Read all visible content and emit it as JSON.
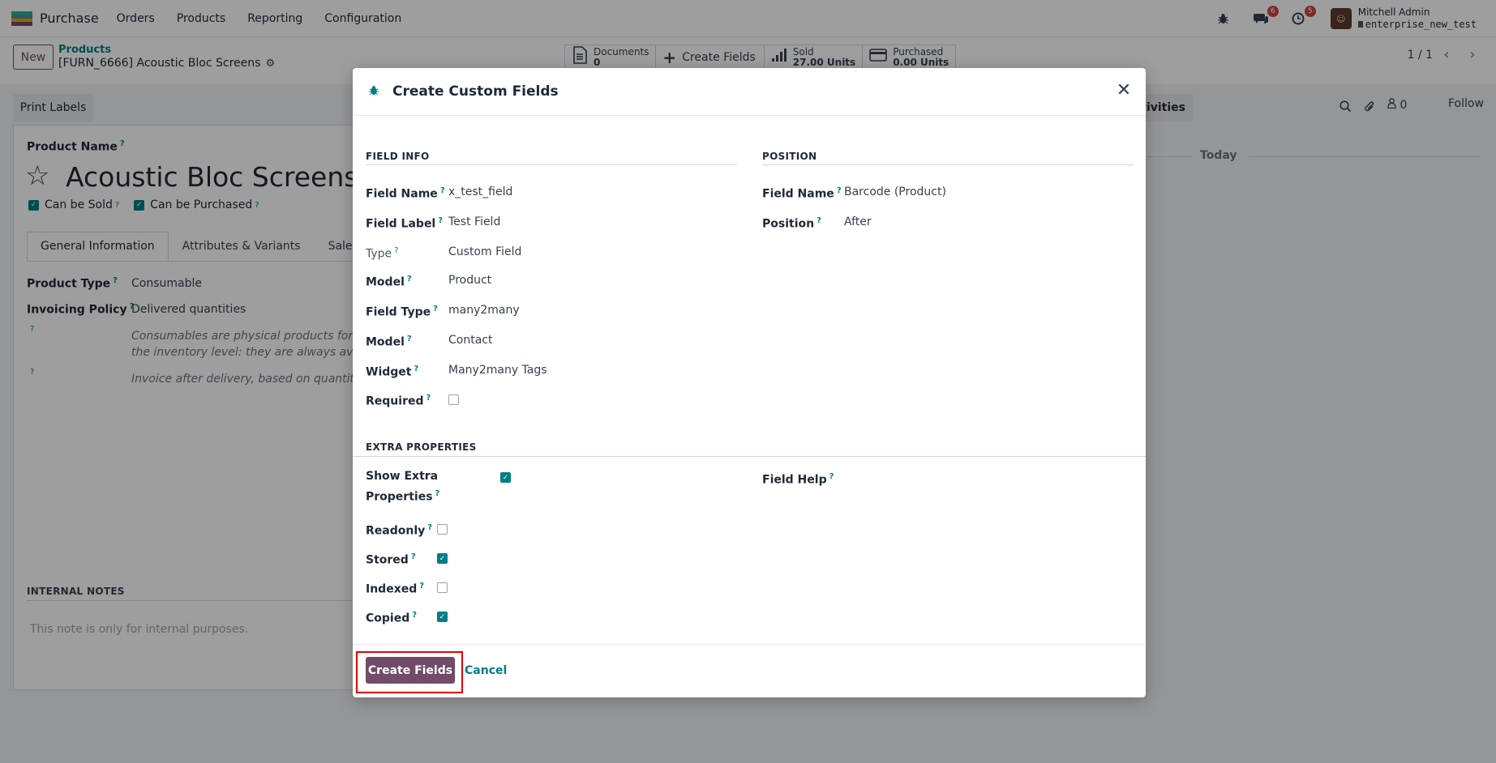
{
  "navbar": {
    "brand": "Purchase",
    "menu": [
      "Orders",
      "Products",
      "Reporting",
      "Configuration"
    ],
    "chat_badge": "6",
    "activity_badge": "5",
    "user_name": "Mitchell Admin",
    "user_db": "enterprise_new_test"
  },
  "control": {
    "new_label": "New",
    "breadcrumb_parent": "Products",
    "breadcrumb_current": "[FURN_6666] Acoustic Bloc Screens",
    "pager": "1 / 1",
    "stats": {
      "documents_label": "Documents",
      "documents_value": "0",
      "create_fields_label": "Create Fields",
      "sold_label": "Sold",
      "sold_value": "27.00 Units",
      "purchased_label": "Purchased",
      "purchased_value": "0.00 Units"
    }
  },
  "form": {
    "print_labels": "Print Labels",
    "product_name_label": "Product Name",
    "product_name": "Acoustic Bloc Screens",
    "can_be_sold": "Can be Sold",
    "can_be_purchased": "Can be Purchased",
    "tabs": [
      "General Information",
      "Attributes & Variants",
      "Sales"
    ],
    "product_type_label": "Product Type",
    "product_type": "Consumable",
    "invoicing_policy_label": "Invoicing Policy",
    "invoicing_policy": "Delivered quantities",
    "note1_line1": "Consumables are physical products for which",
    "note1_line2": "the inventory level: they are always available",
    "note2": "Invoice after delivery, based on quantities de",
    "internal_notes_title": "INTERNAL NOTES",
    "internal_notes_placeholder": "This note is only for internal purposes."
  },
  "chatter": {
    "activities": "ctivities",
    "followers_count": "0",
    "follow": "Follow",
    "today": "Today"
  },
  "modal": {
    "title": "Create Custom Fields",
    "field_info_title": "FIELD INFO",
    "position_title": "POSITION",
    "extra_title": "EXTRA PROPERTIES",
    "field_info": {
      "field_name_label": "Field Name",
      "field_name": "x_test_field",
      "field_label_label": "Field Label",
      "field_label": "Test Field",
      "type_label": "Type",
      "type": "Custom Field",
      "model_label": "Model",
      "model": "Product",
      "field_type_label": "Field Type",
      "field_type": "many2many",
      "model2_label": "Model",
      "model2": "Contact",
      "widget_label": "Widget",
      "widget": "Many2many Tags",
      "required_label": "Required"
    },
    "position": {
      "field_name_label": "Field Name",
      "field_name": "Barcode (Product)",
      "position_label": "Position",
      "position": "After"
    },
    "extra": {
      "show_extra_line1": "Show Extra",
      "show_extra_line2": "Properties",
      "readonly_label": "Readonly",
      "stored_label": "Stored",
      "indexed_label": "Indexed",
      "copied_label": "Copied",
      "field_help_label": "Field Help"
    },
    "create_button": "Create Fields",
    "cancel_button": "Cancel"
  },
  "colors": {
    "primary": "#714b67",
    "teal": "#017e84",
    "highlight": "#e00000"
  }
}
